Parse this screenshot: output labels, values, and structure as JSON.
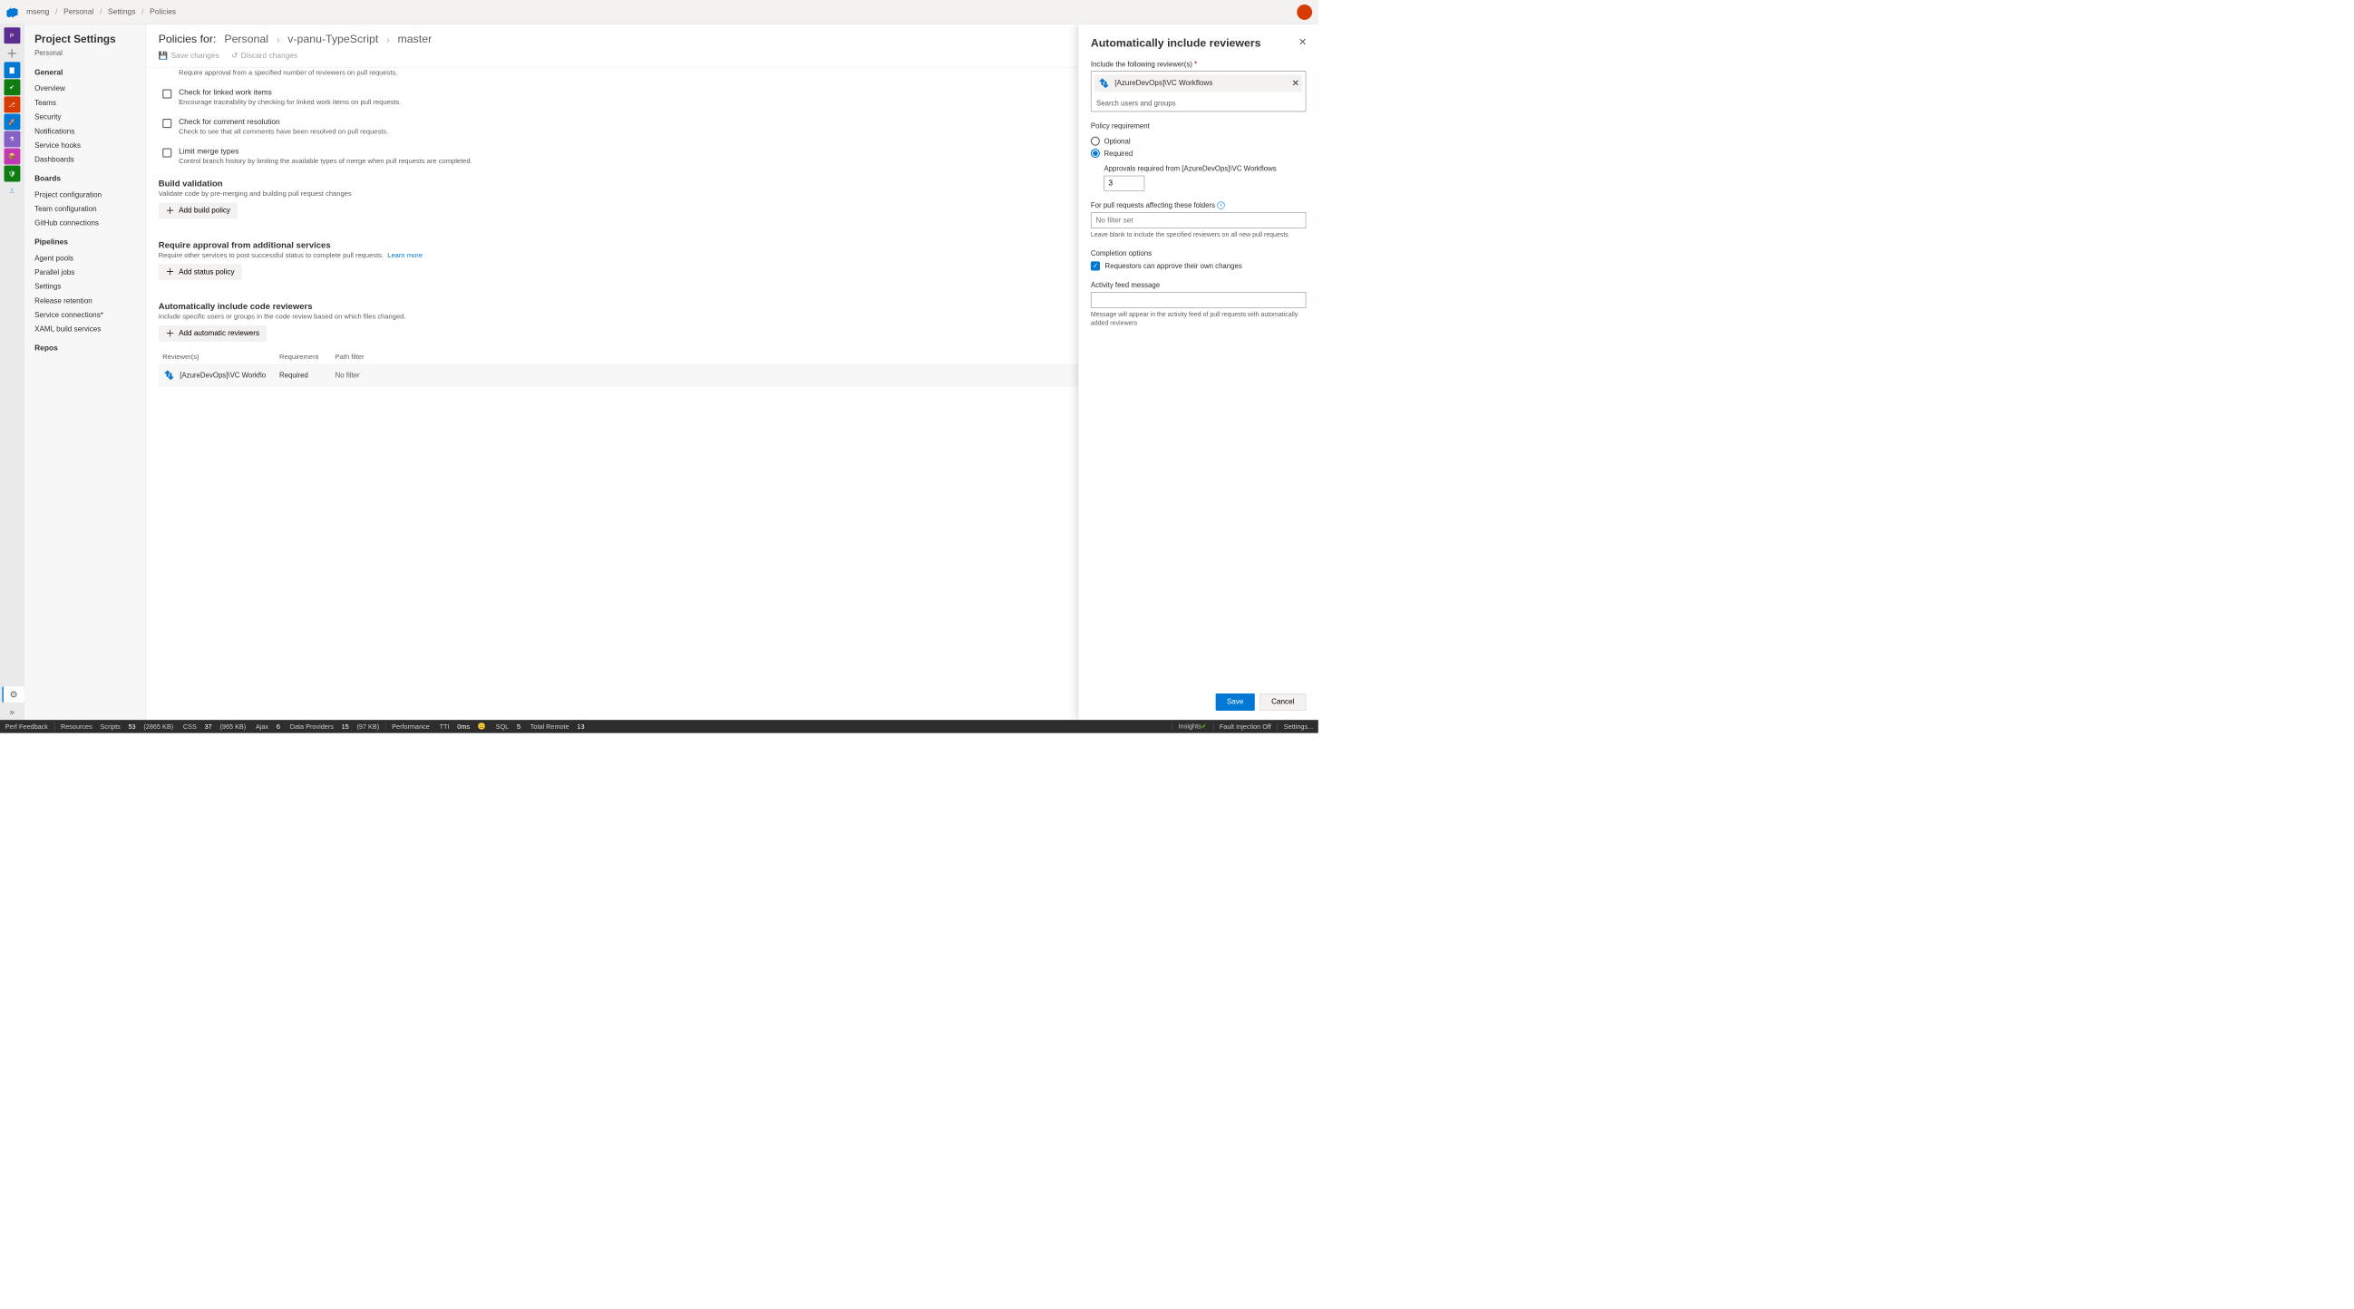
{
  "breadcrumb": {
    "org": "mseng",
    "project": "Personal",
    "section": "Settings",
    "page": "Policies"
  },
  "sidebar": {
    "title": "Project Settings",
    "subtitle": "Personal",
    "groups": [
      {
        "name": "General",
        "items": [
          "Overview",
          "Teams",
          "Security",
          "Notifications",
          "Service hooks",
          "Dashboards"
        ]
      },
      {
        "name": "Boards",
        "items": [
          "Project configuration",
          "Team configuration",
          "GitHub connections"
        ]
      },
      {
        "name": "Pipelines",
        "items": [
          "Agent pools",
          "Parallel jobs",
          "Settings",
          "Release retention",
          "Service connections*",
          "XAML build services"
        ]
      },
      {
        "name": "Repos",
        "items": []
      }
    ]
  },
  "main": {
    "prefix": "Policies for:",
    "path": [
      "Personal",
      "v-panu-TypeScript",
      "master"
    ],
    "save_label": "Save changes",
    "discard_label": "Discard changes",
    "truncated_desc": "Require approval from a specified number of reviewers on pull requests.",
    "policies": [
      {
        "title": "Check for linked work items",
        "desc": "Encourage traceability by checking for linked work items on pull requests."
      },
      {
        "title": "Check for comment resolution",
        "desc": "Check to see that all comments have been resolved on pull requests."
      },
      {
        "title": "Limit merge types",
        "desc": "Control branch history by limiting the available types of merge when pull requests are completed."
      }
    ],
    "build_validation": {
      "head": "Build validation",
      "desc": "Validate code by pre-merging and building pull request changes",
      "btn": "Add build policy"
    },
    "status_check": {
      "head": "Require approval from additional services",
      "desc": "Require other services to post successful status to complete pull requests.",
      "learn": "Learn more",
      "btn": "Add status policy"
    },
    "auto_reviewers": {
      "head": "Automatically include code reviewers",
      "desc": "Include specific users or groups in the code review based on which files changed.",
      "btn": "Add automatic reviewers",
      "cols": [
        "Reviewer(s)",
        "Requirement",
        "Path filter"
      ],
      "row": {
        "name": "[AzureDevOps]\\VC Workflo",
        "req": "Required",
        "path": "No filter"
      }
    }
  },
  "panel": {
    "title": "Automatically include reviewers",
    "include_label": "Include the following reviewer(s)",
    "chip": "[AzureDevOps]\\VC Workflows",
    "search_placeholder": "Search users and groups",
    "policy_req_label": "Policy requirement",
    "optional": "Optional",
    "required": "Required",
    "approvals_label": "Approvals required from [AzureDevOps]\\VC Workflows",
    "approvals_value": "3",
    "folders_label": "For pull requests affecting these folders",
    "folders_placeholder": "No filter set",
    "folders_hint": "Leave blank to include the specified reviewers on all new pull requests",
    "completion_label": "Completion options",
    "requestors_label": "Requestors can approve their own changes",
    "activity_label": "Activity feed message",
    "activity_hint": "Message will appear in the activity feed of pull requests with automatically added reviewers",
    "save": "Save",
    "cancel": "Cancel"
  },
  "status": {
    "perf": "Perf Feedback",
    "resources": "Resources",
    "scripts_label": "Scripts",
    "scripts_n": "53",
    "scripts_sz": "(2865 KB)",
    "css_label": "CSS",
    "css_n": "37",
    "css_sz": "(965 KB)",
    "ajax_label": "Ajax",
    "ajax_n": "6",
    "dp_label": "Data Providers",
    "dp_n": "15",
    "dp_sz": "(97 KB)",
    "performance": "Performance",
    "tti_label": "TTI",
    "tti_val": "0ms",
    "sql_label": "SQL",
    "sql_n": "5",
    "remote_label": "Total Remote",
    "remote_n": "13",
    "insights": "Insights",
    "fault": "Fault Injection Off",
    "settings": "Settings..."
  }
}
